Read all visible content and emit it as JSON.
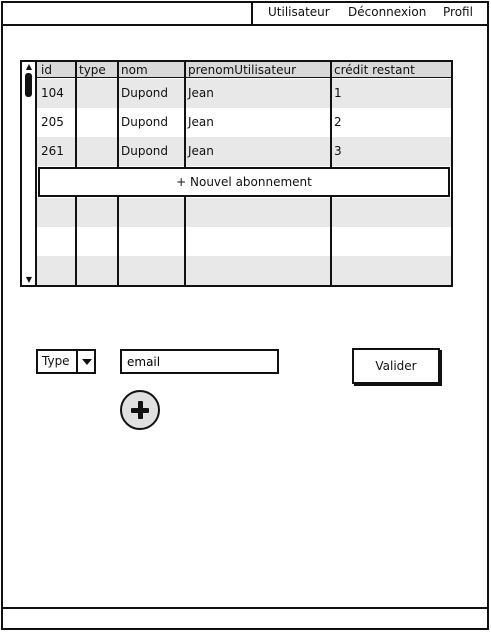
{
  "nav": {
    "items": [
      "Utilisateur",
      "Déconnexion",
      "Profil"
    ]
  },
  "table": {
    "columns": [
      "id",
      "type",
      "nom",
      "prenomUtilisateur",
      "crédit restant"
    ],
    "rows": [
      {
        "id": "104",
        "type": "",
        "nom": "Dupond",
        "prenom": "Jean",
        "credit": "1"
      },
      {
        "id": "205",
        "type": "",
        "nom": "Dupond",
        "prenom": "Jean",
        "credit": "2"
      },
      {
        "id": "261",
        "type": "",
        "nom": "Dupond",
        "prenom": "Jean",
        "credit": "3"
      }
    ],
    "new_subscription_label": "+ Nouvel abonnement"
  },
  "form": {
    "type_label": "Type",
    "email_value": "email",
    "submit_label": "Valider"
  },
  "icons": {
    "scroll_up": "triangle-up",
    "scroll_down": "triangle-down",
    "dropdown": "chevron-down",
    "add": "plus-circle"
  }
}
